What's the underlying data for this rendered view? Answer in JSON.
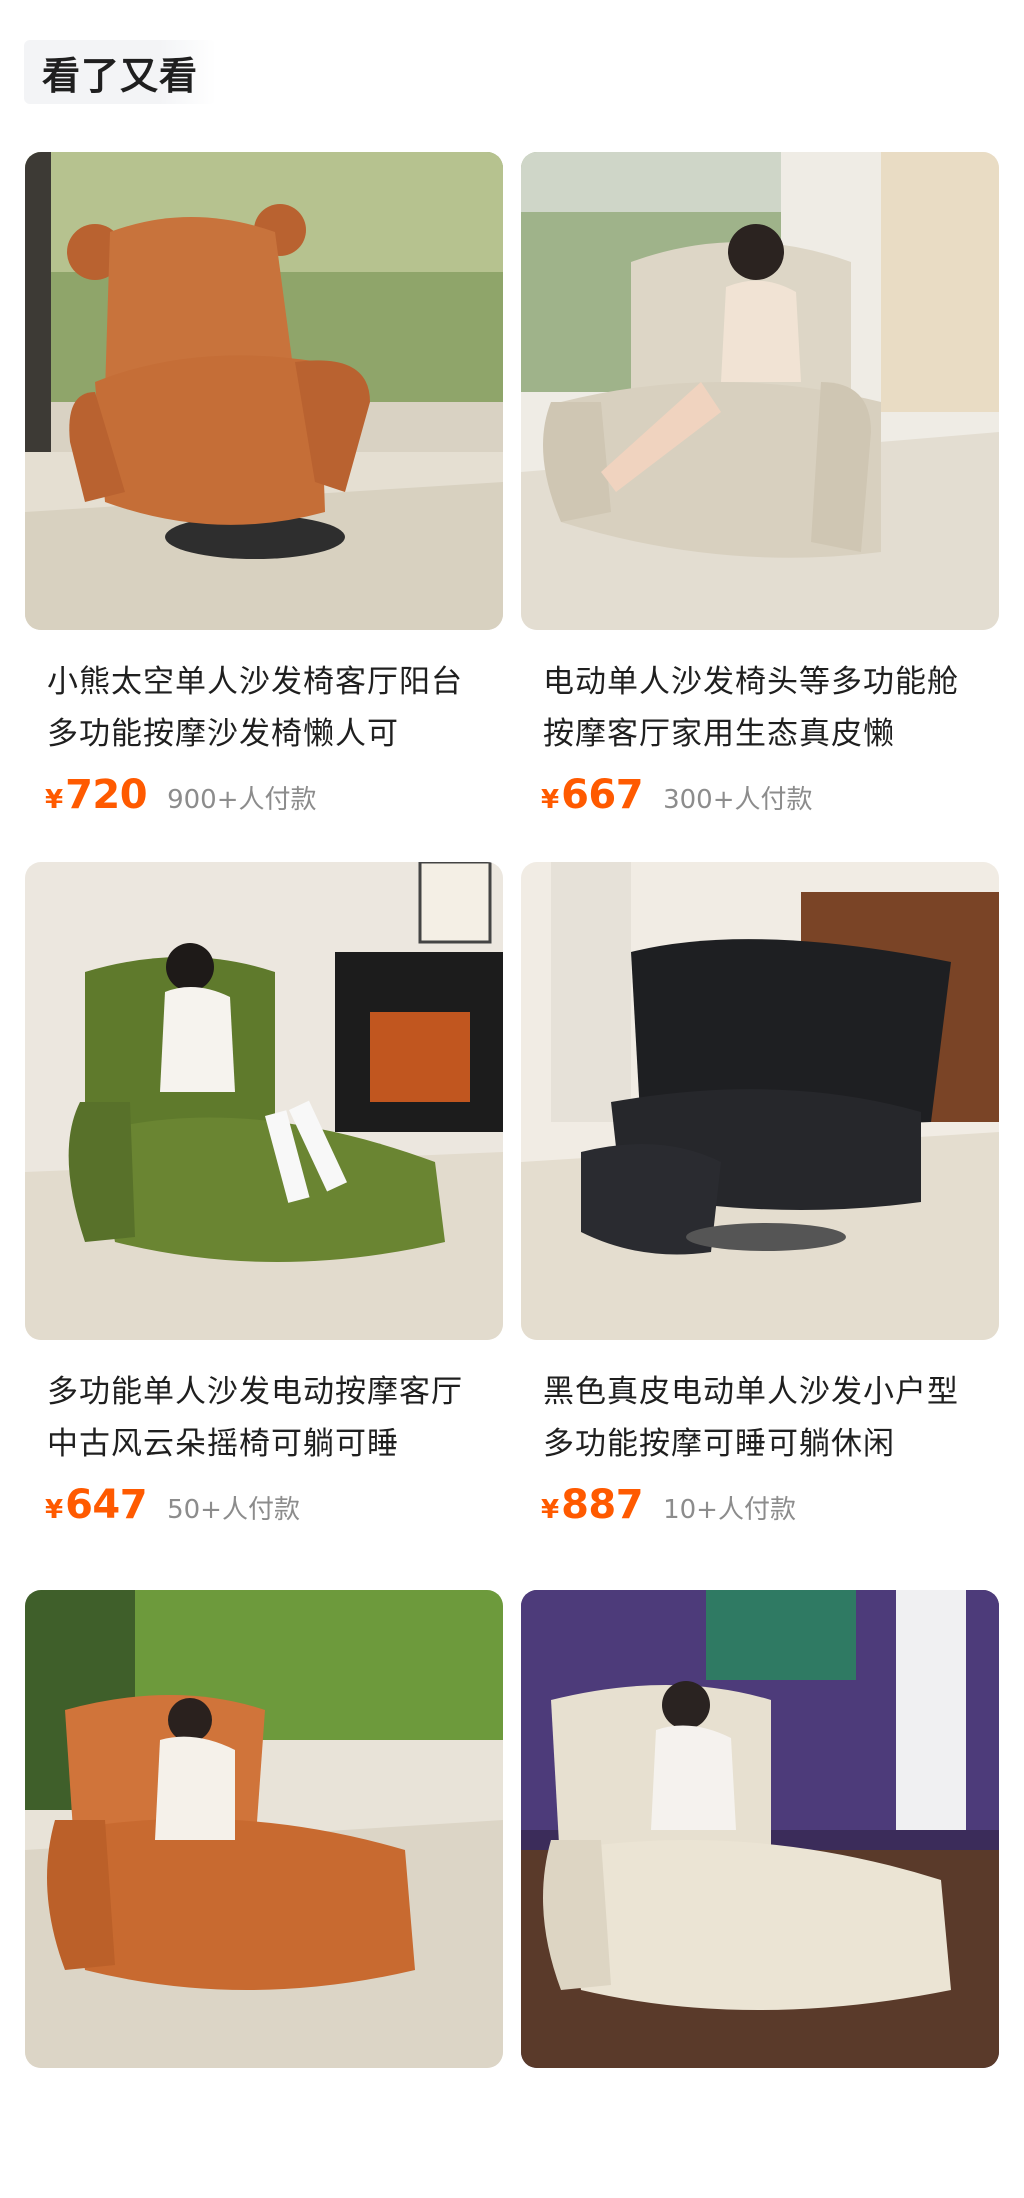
{
  "section": {
    "title": "看了又看"
  },
  "colors": {
    "price": "#ff5a00",
    "sales_text": "#8c8c8c",
    "title_text": "#1f1f1f"
  },
  "products": [
    {
      "title": "小熊太空单人沙发椅客厅阳台多功能按摩沙发椅懒人可",
      "price_symbol": "¥",
      "price": "720",
      "sales": "900+人付款",
      "image_icon": "brown-bear-armchair-photo",
      "sofa_color": "#c8733c"
    },
    {
      "title": "电动单人沙发椅头等多功能舱按摩客厅家用生态真皮懒",
      "price_symbol": "¥",
      "price": "667",
      "sales": "300+人付款",
      "image_icon": "beige-recliner-photo",
      "sofa_color": "#ddd6c6"
    },
    {
      "title": "多功能单人沙发电动按摩客厅中古风云朵摇椅可躺可睡",
      "price_symbol": "¥",
      "price": "647",
      "sales": "50+人付款",
      "image_icon": "green-cloud-recliner-photo",
      "sofa_color": "#5f7a2c"
    },
    {
      "title": "黑色真皮电动单人沙发小户型多功能按摩可睡可躺休闲",
      "price_symbol": "¥",
      "price": "887",
      "sales": "10+人付款",
      "image_icon": "black-leather-recliner-photo",
      "sofa_color": "#1e1f22"
    },
    {
      "title": "",
      "price_symbol": "",
      "price": "",
      "sales": "",
      "image_icon": "orange-outdoor-recliner-photo",
      "sofa_color": "#d0743a"
    },
    {
      "title": "",
      "price_symbol": "",
      "price": "",
      "sales": "",
      "image_icon": "cream-gaming-recliner-photo",
      "sofa_color": "#e7e0d0"
    }
  ]
}
